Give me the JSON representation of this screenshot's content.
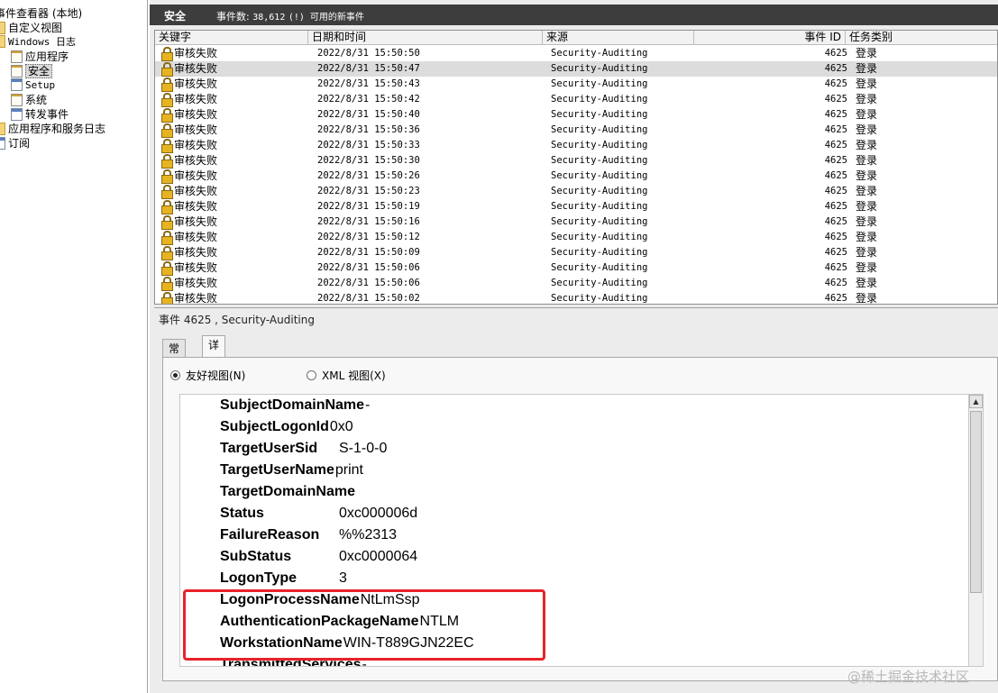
{
  "tree": {
    "items": [
      {
        "label": "事件查看器 (本地)",
        "icon": "event-viewer-icon"
      },
      {
        "label": "自定义视图",
        "icon": "folder-icon"
      },
      {
        "label": "Windows 日志",
        "icon": "folder-icon"
      },
      {
        "label": "应用程序",
        "icon": "log-icon"
      },
      {
        "label": "安全",
        "icon": "log-icon",
        "selected": true
      },
      {
        "label": "Setup",
        "icon": "log-icon"
      },
      {
        "label": "系统",
        "icon": "log-icon"
      },
      {
        "label": "转发事件",
        "icon": "log-icon"
      },
      {
        "label": "应用程序和服务日志",
        "icon": "folder-icon"
      },
      {
        "label": "订阅",
        "icon": "subscription-icon"
      }
    ]
  },
  "header": {
    "title": "安全",
    "count_prefix": "事件数:",
    "count": "38,612",
    "count_note": "(!) 可用的新事件"
  },
  "grid": {
    "columns": [
      "关键字",
      "日期和时间",
      "来源",
      "事件 ID",
      "任务类别"
    ],
    "rows": [
      {
        "keyword": "审核失败",
        "datetime": "2022/8/31 15:50:50",
        "source": "Security-Auditing",
        "id": "4625",
        "task": "登录"
      },
      {
        "keyword": "审核失败",
        "datetime": "2022/8/31 15:50:47",
        "source": "Security-Auditing",
        "id": "4625",
        "task": "登录",
        "selected": true
      },
      {
        "keyword": "审核失败",
        "datetime": "2022/8/31 15:50:43",
        "source": "Security-Auditing",
        "id": "4625",
        "task": "登录"
      },
      {
        "keyword": "审核失败",
        "datetime": "2022/8/31 15:50:42",
        "source": "Security-Auditing",
        "id": "4625",
        "task": "登录"
      },
      {
        "keyword": "审核失败",
        "datetime": "2022/8/31 15:50:40",
        "source": "Security-Auditing",
        "id": "4625",
        "task": "登录"
      },
      {
        "keyword": "审核失败",
        "datetime": "2022/8/31 15:50:36",
        "source": "Security-Auditing",
        "id": "4625",
        "task": "登录"
      },
      {
        "keyword": "审核失败",
        "datetime": "2022/8/31 15:50:33",
        "source": "Security-Auditing",
        "id": "4625",
        "task": "登录"
      },
      {
        "keyword": "审核失败",
        "datetime": "2022/8/31 15:50:30",
        "source": "Security-Auditing",
        "id": "4625",
        "task": "登录"
      },
      {
        "keyword": "审核失败",
        "datetime": "2022/8/31 15:50:26",
        "source": "Security-Auditing",
        "id": "4625",
        "task": "登录"
      },
      {
        "keyword": "审核失败",
        "datetime": "2022/8/31 15:50:23",
        "source": "Security-Auditing",
        "id": "4625",
        "task": "登录"
      },
      {
        "keyword": "审核失败",
        "datetime": "2022/8/31 15:50:19",
        "source": "Security-Auditing",
        "id": "4625",
        "task": "登录"
      },
      {
        "keyword": "审核失败",
        "datetime": "2022/8/31 15:50:16",
        "source": "Security-Auditing",
        "id": "4625",
        "task": "登录"
      },
      {
        "keyword": "审核失败",
        "datetime": "2022/8/31 15:50:12",
        "source": "Security-Auditing",
        "id": "4625",
        "task": "登录"
      },
      {
        "keyword": "审核失败",
        "datetime": "2022/8/31 15:50:09",
        "source": "Security-Auditing",
        "id": "4625",
        "task": "登录"
      },
      {
        "keyword": "审核失败",
        "datetime": "2022/8/31 15:50:06",
        "source": "Security-Auditing",
        "id": "4625",
        "task": "登录"
      },
      {
        "keyword": "审核失败",
        "datetime": "2022/8/31 15:50:06",
        "source": "Security-Auditing",
        "id": "4625",
        "task": "登录"
      },
      {
        "keyword": "审核失败",
        "datetime": "2022/8/31 15:50:02",
        "source": "Security-Auditing",
        "id": "4625",
        "task": "登录"
      }
    ]
  },
  "detail": {
    "title": "事件 4625 , Security-Auditing",
    "tabs": [
      "常规",
      "详细信息"
    ],
    "active_tab": "详细信息",
    "view_options": [
      {
        "label": "友好视图(N)",
        "checked": true
      },
      {
        "label": "XML 视图(X)",
        "checked": false
      }
    ],
    "properties": [
      {
        "key": "SubjectDomainName",
        "value": "-"
      },
      {
        "key": "SubjectLogonId",
        "value": "0x0"
      },
      {
        "key": "TargetUserSid",
        "value": "S-1-0-0"
      },
      {
        "key": "TargetUserName",
        "value": "print"
      },
      {
        "key": "TargetDomainName",
        "value": ""
      },
      {
        "key": "Status",
        "value": "0xc000006d"
      },
      {
        "key": "FailureReason",
        "value": "%%2313"
      },
      {
        "key": "SubStatus",
        "value": "0xc0000064"
      },
      {
        "key": "LogonType",
        "value": "3"
      },
      {
        "key": "LogonProcessName",
        "value": "NtLmSsp"
      },
      {
        "key": "AuthenticationPackageName",
        "value": "NTLM"
      },
      {
        "key": "WorkstationName",
        "value": "WIN-T889GJN22EC"
      },
      {
        "key": "TransmittedServices",
        "value": "-"
      }
    ],
    "highlight_color": "#e8222a"
  },
  "watermark": "@稀土掘金技术社区"
}
